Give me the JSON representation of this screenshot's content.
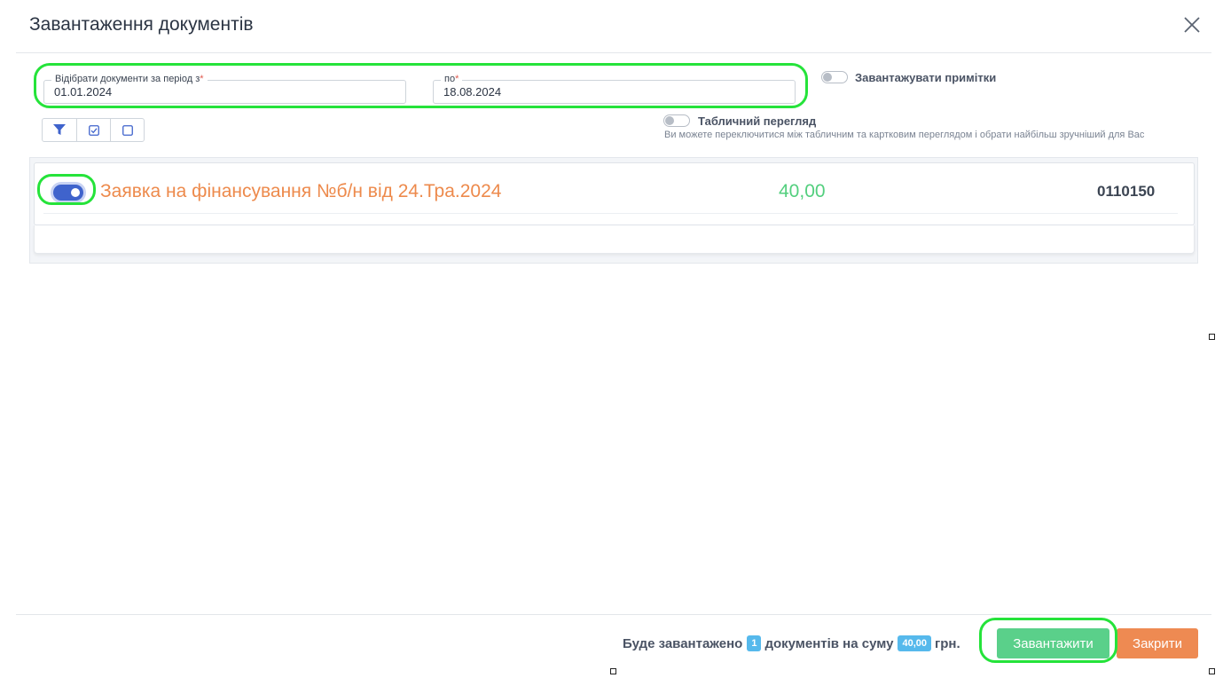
{
  "modal": {
    "title": "Завантаження документів",
    "close_icon": "close-icon"
  },
  "filters": {
    "date_from": {
      "label": "Відібрати документи за період з",
      "required_mark": "*",
      "value": "01.01.2024"
    },
    "date_to": {
      "label": "по",
      "required_mark": "*",
      "value": "18.08.2024"
    }
  },
  "toggles": {
    "load_notes": {
      "label": "Завантажувати примітки",
      "state": "off"
    },
    "table_view": {
      "label": "Табличний перегляд",
      "hint": "Ви можете переключитися між табличним та картковим переглядом і обрати найбільш зручніший для Вас",
      "state": "off"
    }
  },
  "toolbar": {
    "icons": [
      "filter-icon",
      "check-all-icon",
      "uncheck-all-icon"
    ]
  },
  "documents": [
    {
      "selected": true,
      "title": "Заявка на фінансування №б/н від 24.Тра.2024",
      "amount": "40,00",
      "code": "0110150"
    }
  ],
  "footer": {
    "text_before": "Буде завантажено",
    "count": "1",
    "text_middle": "документів на суму",
    "sum": "40,00",
    "currency": "грн.",
    "upload_label": "Завантажити",
    "close_label": "Закрити"
  },
  "colors": {
    "accent_blue": "#3f63cc",
    "doc_title": "#ed8a4c",
    "amount_green": "#53cf7e",
    "upload_button": "#5ad08a",
    "close_button": "#ee8a52",
    "badge": "#56b9ec",
    "highlight": "#25e33a"
  }
}
